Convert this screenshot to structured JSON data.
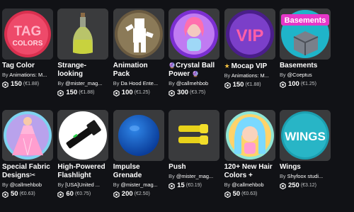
{
  "items": [
    {
      "prefix": "",
      "name": "Tag Color",
      "suffix": "",
      "creator": "Animations: M...",
      "price": "150",
      "usd": "(€1.88)",
      "icon": "tag-colors-thumbnail"
    },
    {
      "prefix": "",
      "name": "Strange-looking",
      "suffix": "",
      "creator": "@mister_mag...",
      "price": "150",
      "usd": "(€1.88)",
      "icon": "bottle-thumbnail"
    },
    {
      "prefix": "",
      "name": "Animation Pack",
      "suffix": "",
      "creator": "Da Hood Ente...",
      "price": "100",
      "usd": "(€1.25)",
      "icon": "animation-pack-thumbnail"
    },
    {
      "prefix": "🔮",
      "name": "Crystal Ball Power",
      "suffix": "🔮",
      "creator": "@callmehbob",
      "price": "300",
      "usd": "(€3.75)",
      "icon": "crystal-ball-thumbnail"
    },
    {
      "prefix": "★",
      "name": "Mocap VIP",
      "suffix": "",
      "creator": "Animations: M...",
      "price": "150",
      "usd": "(€1.88)",
      "icon": "vip-thumbnail"
    },
    {
      "prefix": "",
      "name": "Basements",
      "suffix": "",
      "creator": "@Coeptus",
      "price": "100",
      "usd": "(€1.25)",
      "icon": "basements-thumbnail"
    },
    {
      "prefix": "",
      "name": "Special Fabric Designs",
      "suffix": "✂",
      "creator": "@callmehbob",
      "price": "50",
      "usd": "(€0.63)",
      "icon": "fabric-dress-thumbnail"
    },
    {
      "prefix": "",
      "name": "High-Powered Flashlight",
      "suffix": "",
      "creator": "[USA]United ...",
      "price": "60",
      "usd": "(€0.75)",
      "icon": "flashlight-thumbnail"
    },
    {
      "prefix": "",
      "name": "Impulse Grenade",
      "suffix": "",
      "creator": "@mister_mag...",
      "price": "200",
      "usd": "(€2.50)",
      "icon": "blue-sphere-thumbnail"
    },
    {
      "prefix": "",
      "name": "Push",
      "suffix": "",
      "creator": "@mister_mag...",
      "price": "15",
      "usd": "(€0.19)",
      "icon": "push-hands-thumbnail"
    },
    {
      "prefix": "",
      "name": "120+ New Hair Colors +",
      "suffix": "",
      "creator": "@callmehbob",
      "price": "50",
      "usd": "(€0.63)",
      "icon": "hair-colors-thumbnail"
    },
    {
      "prefix": "",
      "name": "Wings",
      "suffix": "",
      "creator": "Shyfoox studi...",
      "price": "250",
      "usd": "(€3.12)",
      "icon": "wings-thumbnail"
    }
  ],
  "by_label": "By",
  "thumb_text": {
    "tag_line1": "TAG",
    "tag_line2": "COLORS",
    "vip": "VIP",
    "basements": "Basements",
    "wings": "WINGS"
  },
  "colors": {
    "background": "#111216",
    "card": "#393b3d",
    "secondary_text": "#c3c5c7"
  }
}
